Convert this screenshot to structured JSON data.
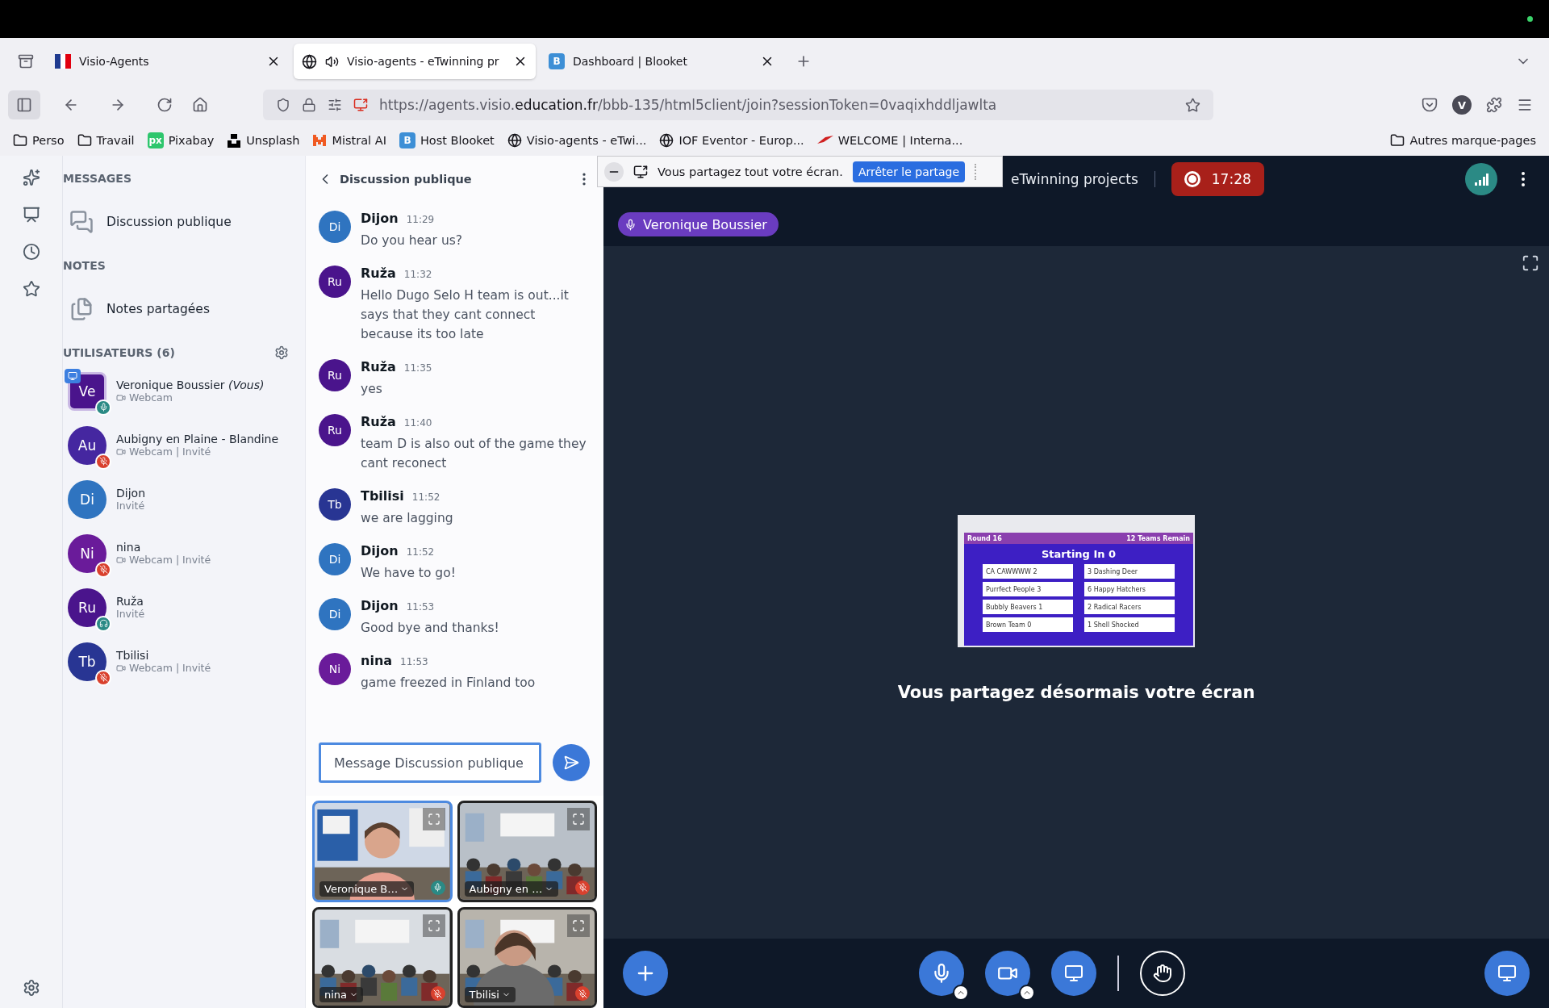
{
  "browser": {
    "tabs": [
      {
        "title": "Visio-Agents",
        "selected": false,
        "kind": "flag",
        "audio": false
      },
      {
        "title": "Visio-agents - eTwinning pr",
        "selected": true,
        "kind": "globe",
        "audio": true
      },
      {
        "title": "Dashboard | Blooket",
        "selected": false,
        "kind": "letter",
        "letter": "B",
        "audio": false
      }
    ],
    "url": {
      "pre": "https://agents.visio.",
      "host": "education.fr",
      "path": "/bbb-135/html5client/join?sessionToken=0vaqixhddljawlta"
    },
    "profile_initial": "V",
    "bookmarks": [
      {
        "label": "Perso",
        "kind": "folder"
      },
      {
        "label": "Travail",
        "kind": "folder"
      },
      {
        "label": "Pixabay",
        "kind": "badge",
        "badge": "px",
        "color": "#2ec66d"
      },
      {
        "label": "Unsplash",
        "kind": "unsplash"
      },
      {
        "label": "Mistral AI",
        "kind": "mistral"
      },
      {
        "label": "Host Blooket",
        "kind": "badge",
        "badge": "B",
        "color": "#3d8fd6"
      },
      {
        "label": "Visio-agents - eTwi...",
        "kind": "globe"
      },
      {
        "label": "IOF Eventor - Europ...",
        "kind": "globe"
      },
      {
        "label": "WELCOME | Interna...",
        "kind": "logo"
      }
    ],
    "other_bookmarks": "Autres marque-pages"
  },
  "users_panel": {
    "messages_heading": "MESSAGES",
    "chat_link": "Discussion publique",
    "notes_heading": "NOTES",
    "notes_link": "Notes partagées",
    "users_heading": "UTILISATEURS (6)",
    "users": [
      {
        "initials": "Ve",
        "name": "Veronique Boussier",
        "you": "(Vous)",
        "sub": "Webcam",
        "webcam": true,
        "presenter": true,
        "kind": "talker",
        "color": "#4a148c"
      },
      {
        "initials": "Au",
        "name": "Aubigny en Plaine - Blandine",
        "sub": "Webcam | Invité",
        "webcam": true,
        "presenter": false,
        "kind": "muted",
        "color": "#4527a0"
      },
      {
        "initials": "Di",
        "name": "Dijon",
        "sub": "Invité",
        "webcam": false,
        "presenter": false,
        "kind": "plain",
        "color": "#2f74c0"
      },
      {
        "initials": "Ni",
        "name": "nina",
        "sub": "Webcam | Invité",
        "webcam": true,
        "presenter": false,
        "kind": "muted",
        "color": "#6a1b9a"
      },
      {
        "initials": "Ru",
        "name": "Ruža",
        "sub": "Invité",
        "webcam": false,
        "presenter": false,
        "kind": "listener",
        "color": "#4a148c"
      },
      {
        "initials": "Tb",
        "name": "Tbilisi",
        "sub": "Webcam | Invité",
        "webcam": true,
        "presenter": false,
        "kind": "muted",
        "color": "#283593"
      }
    ]
  },
  "chat": {
    "title": "Discussion publique",
    "messages": [
      {
        "initials": "Di",
        "author": "Dijon",
        "time": "11:29",
        "text": "Do you hear us?",
        "color": "#2f74c0"
      },
      {
        "initials": "Ru",
        "author": "Ruža",
        "time": "11:32",
        "text": "Hello Dugo Selo H team is out...it says that they cant connect because its too late",
        "color": "#4a148c"
      },
      {
        "initials": "Ru",
        "author": "Ruža",
        "time": "11:35",
        "text": "yes",
        "color": "#4a148c"
      },
      {
        "initials": "Ru",
        "author": "Ruža",
        "time": "11:40",
        "text": "team D is also out of the game they cant reconect",
        "color": "#4a148c"
      },
      {
        "initials": "Tb",
        "author": "Tbilisi",
        "time": "11:52",
        "text": "we are lagging",
        "color": "#283593"
      },
      {
        "initials": "Di",
        "author": "Dijon",
        "time": "11:52",
        "text": "We have to go!",
        "color": "#2f74c0"
      },
      {
        "initials": "Di",
        "author": "Dijon",
        "time": "11:53",
        "text": "Good bye and thanks!",
        "color": "#2f74c0"
      },
      {
        "initials": "Ni",
        "author": "nina",
        "time": "11:53",
        "text": "game freezed in Finland too",
        "color": "#6a1b9a"
      }
    ],
    "placeholder": "Message Discussion publique"
  },
  "video_tiles": [
    {
      "name": "Veronique B…",
      "selected": true,
      "muted": false,
      "kind": "picture"
    },
    {
      "name": "Aubigny en …",
      "selected": false,
      "muted": true,
      "kind": "picture"
    },
    {
      "name": "nina",
      "selected": false,
      "muted": true,
      "kind": "picture"
    },
    {
      "name": "Tbilisi",
      "selected": false,
      "muted": true,
      "kind": "picture"
    }
  ],
  "share_bar": {
    "message": "Vous partagez tout votre écran.",
    "button": "Arrêter le partage"
  },
  "meeting": {
    "title": "eTwinning projects",
    "recording": {
      "on": true,
      "time": "17:28"
    },
    "presenter": "Veronique Boussier",
    "status": "Vous partagez désormais votre écran"
  },
  "shared_screen": {
    "round": "Round 16",
    "remaining": "12 Teams Remain",
    "heading": "Starting In 0",
    "matches": [
      {
        "left": "CA CAWWWW",
        "left_score": "2",
        "right": "Dashing Deer",
        "right_score": "3"
      },
      {
        "left": "Purrfect People",
        "left_score": "3",
        "right": "Happy Hatchers",
        "right_score": "6"
      },
      {
        "left": "Bubbly Beavers",
        "left_score": "1",
        "right": "Radical Racers",
        "right_score": "2"
      },
      {
        "left": "Brown Team",
        "left_score": "0",
        "right": "Shell Shocked",
        "right_score": "1"
      }
    ]
  },
  "controls": [
    {
      "kind": "plus"
    },
    {
      "kind": "mic",
      "menu": true
    },
    {
      "kind": "camera",
      "menu": true
    },
    {
      "kind": "screen"
    },
    {
      "kind": "divider"
    },
    {
      "kind": "hand"
    },
    {
      "kind": "layout"
    }
  ]
}
